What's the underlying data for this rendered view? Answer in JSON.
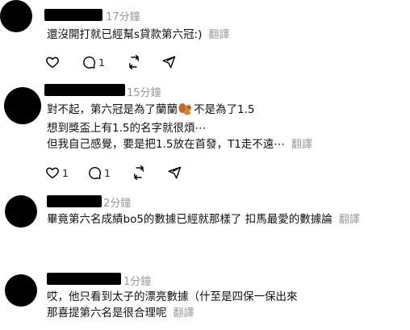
{
  "posts": [
    {
      "time": "17分鐘",
      "lines": [
        "還沒開打就已經幫s貸款第六冠:)"
      ],
      "translate": "翻譯",
      "replies": "1",
      "likes": ""
    },
    {
      "time": "15分鐘",
      "line1_a": "對不起，第六冠是為了蘭蘭",
      "line1_b": "不是為了1.5",
      "line2": "想到獎盃上有1.5的名字就很煩⋯",
      "line3": "但我自己感覺，要是把1.5放在首發，T1走不遠⋯",
      "translate": "翻譯",
      "likes": "1",
      "replies": "1"
    },
    {
      "time": "2分鐘",
      "lines": [
        "畢竟第六名成績bo5的數據已經就那樣了 扣馬最愛的數據論"
      ],
      "translate": "翻譯"
    },
    {
      "time": "1分鐘",
      "line1": "哎，他只看到太子的漂亮數據（什至是四保一保出來",
      "line2": "那喜提第六名是很合理呢",
      "translate": "翻譯"
    }
  ]
}
